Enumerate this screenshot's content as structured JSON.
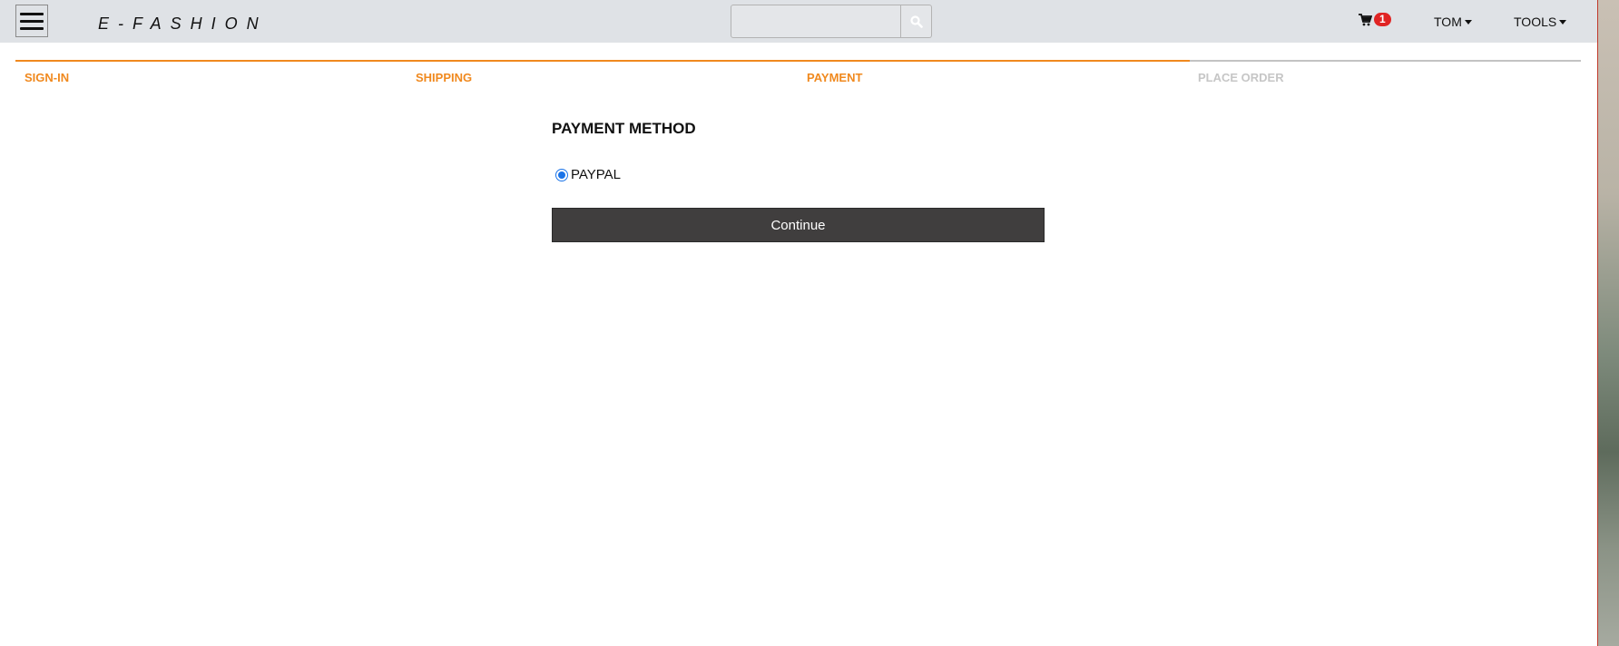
{
  "header": {
    "brand": "E-FASHION",
    "search": {
      "value": "",
      "placeholder": ""
    },
    "cart": {
      "count": "1"
    },
    "user_menu": "TOM",
    "tools_menu": "TOOLS"
  },
  "steps": [
    {
      "label": "SIGN-IN",
      "state": "done"
    },
    {
      "label": "SHIPPING",
      "state": "done"
    },
    {
      "label": "PAYMENT",
      "state": "current"
    },
    {
      "label": "PLACE ORDER",
      "state": "todo"
    }
  ],
  "payment": {
    "title": "PAYMENT METHOD",
    "options": [
      {
        "label": "PAYPAL",
        "selected": true
      }
    ],
    "continue_label": "Continue"
  },
  "colors": {
    "accent": "#f0891e",
    "header_bg": "#dfe2e6",
    "button_bg": "#403e3e",
    "badge": "#e02424",
    "inactive": "#c6c6c6"
  },
  "icons": [
    "hamburger-icon",
    "search-icon",
    "cart-icon",
    "caret-down-icon"
  ]
}
